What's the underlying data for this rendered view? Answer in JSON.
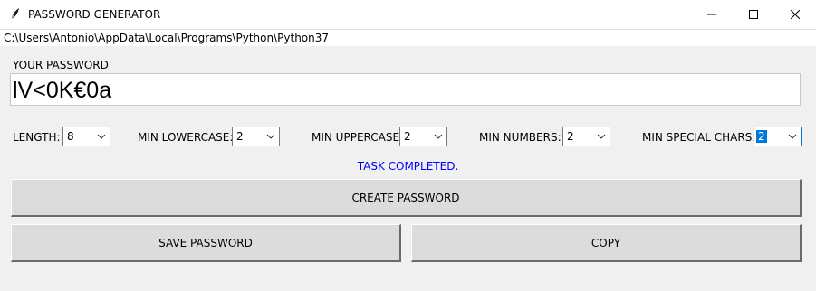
{
  "window": {
    "title": "PASSWORD GENERATOR",
    "path": "C:\\Users\\Antonio\\AppData\\Local\\Programs\\Python\\Python37"
  },
  "password": {
    "label": "YOUR PASSWORD",
    "value": "lV<0K€0a"
  },
  "options": [
    {
      "label": "LENGTH:",
      "value": "8"
    },
    {
      "label": "MIN LOWERCASE:",
      "value": "2"
    },
    {
      "label": "MIN UPPERCASE:",
      "value": "2"
    },
    {
      "label": "MIN NUMBERS:",
      "value": "2"
    },
    {
      "label": "MIN SPECIAL CHARS:",
      "value": "2"
    }
  ],
  "status": {
    "text": "TASK COMPLETED.",
    "color": "#0000ff"
  },
  "buttons": {
    "create": "CREATE PASSWORD",
    "save": "SAVE PASSWORD",
    "copy": "COPY"
  },
  "icons": {
    "app": "feather-icon",
    "minimize": "minimize-icon",
    "maximize": "maximize-icon",
    "close": "close-icon",
    "dropdown": "chevron-down-icon"
  }
}
